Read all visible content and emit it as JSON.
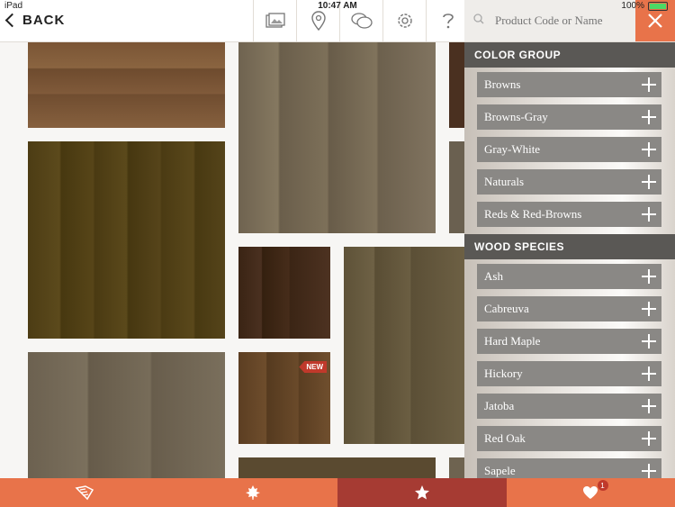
{
  "status_bar": {
    "device": "iPad",
    "time": "10:47 AM",
    "battery": "100%",
    "battery_level": 1.0
  },
  "top_bar": {
    "back_label": "BACK",
    "icons": [
      "photo-gallery-icon",
      "location-pin-icon",
      "chat-bubbles-icon",
      "settings-gear-icon",
      "help-question-icon"
    ],
    "search": {
      "placeholder": "Product Code or Name",
      "value": ""
    }
  },
  "filters": {
    "color_group": {
      "title": "COLOR GROUP",
      "items": [
        "Browns",
        "Browns-Gray",
        "Gray-White",
        "Naturals",
        "Reds & Red-Browns"
      ]
    },
    "wood_species": {
      "title": "WOOD SPECIES",
      "items": [
        "Ash",
        "Cabreuva",
        "Hard Maple",
        "Hickory",
        "Jatoba",
        "Red Oak",
        "Sapele"
      ]
    }
  },
  "products": {
    "new_badge": "NEW"
  },
  "bottom_bar": {
    "tabs": [
      "brochure-icon",
      "maple-leaf-icon",
      "star-icon",
      "heart-icon"
    ],
    "active_tab": 2,
    "favorites_count": "1"
  },
  "colors": {
    "accent": "#e8734a",
    "active_tab": "#a63b33",
    "section_header": "#5a5855",
    "filter_item": "#8a8885"
  }
}
